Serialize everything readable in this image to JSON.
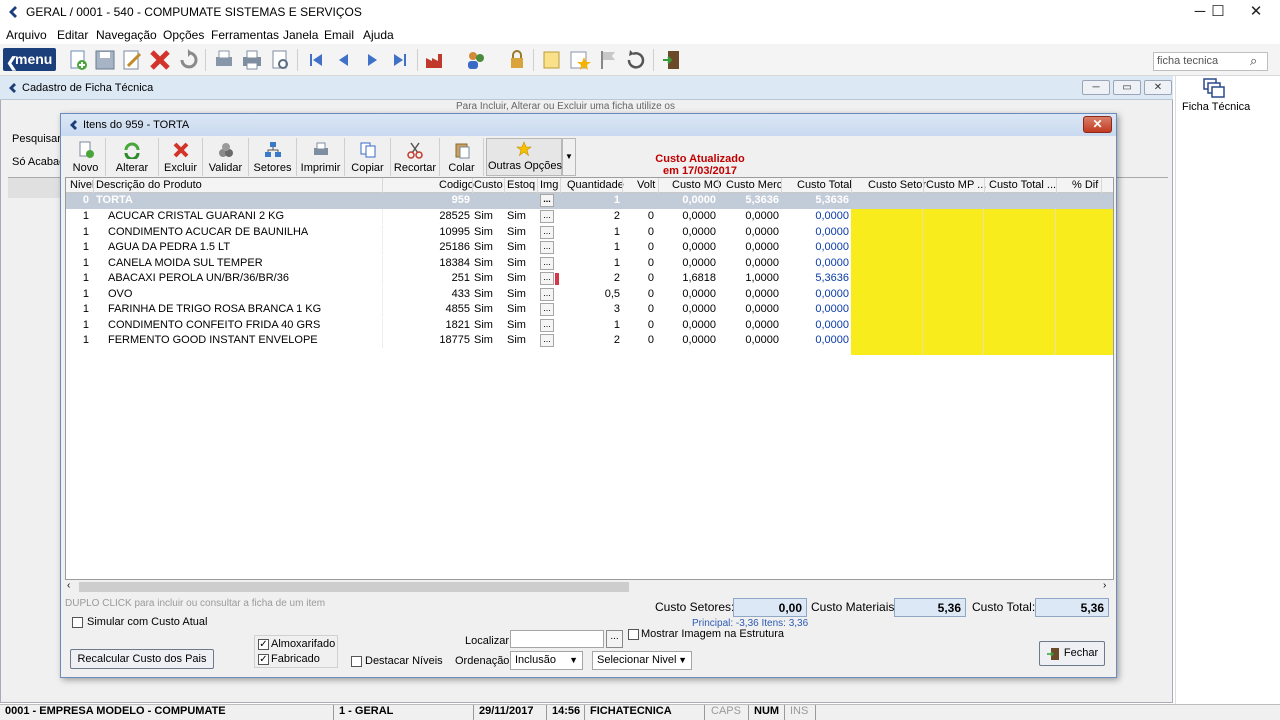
{
  "window": {
    "title": "GERAL / 0001 - 540 - COMPUMATE SISTEMAS E SERVIÇOS",
    "min": "─",
    "max": "☐",
    "close": "✕"
  },
  "menu": [
    "Arquivo",
    "Editar",
    "Navegação",
    "Opções",
    "Ferramentas",
    "Janela",
    "Email",
    "Ajuda"
  ],
  "toolbar": {
    "menu_label": "menu",
    "menu_glyph": "❮"
  },
  "search": {
    "value": "ficha tecnica"
  },
  "right_panel": {
    "label": "Ficha Técnica"
  },
  "bg_window": {
    "title": "Cadastro de Ficha Técnica",
    "hint": "Para Incluir, Alterar ou Excluir uma ficha utilize os",
    "pesquisar": "Pesquisar F",
    "so_acabados": "Só Acabad"
  },
  "dialog": {
    "title": "Itens do 959 - TORTA",
    "close": "✕",
    "buttons": [
      "Novo",
      "Alterar",
      "Excluir",
      "Validar",
      "Setores",
      "Imprimir",
      "Copiar",
      "Recortar",
      "Colar"
    ],
    "outras": "Outras Opções",
    "custo_line1": "Custo Atualizado",
    "custo_line2": "em 17/03/2017",
    "columns": [
      "Nivel",
      "Descrição do Produto",
      "Codigo",
      "Custo",
      "Estoq",
      "Img",
      "Quantidade",
      "Volt",
      "Custo MO",
      "Custo Merc",
      "Custo Total",
      "Custo Setor",
      "Custo MP ...",
      "Custo Total ...",
      "% Dif"
    ],
    "header_row": {
      "nivel": "0",
      "desc": "TORTA",
      "codigo": "959",
      "img": "...",
      "qtd": "1",
      "mo": "0,0000",
      "merc": "5,3636",
      "total": "5,3636"
    },
    "rows": [
      {
        "nivel": "1",
        "desc": "ACUCAR CRISTAL GUARANI 2 KG",
        "codigo": "28525",
        "custo": "Sim",
        "estoq": "Sim",
        "img": "...",
        "qtd": "2",
        "volt": "0",
        "mo": "0,0000",
        "merc": "0,0000",
        "total": "0,0000"
      },
      {
        "nivel": "1",
        "desc": "CONDIMENTO ACUCAR DE BAUNILHA",
        "codigo": "10995",
        "custo": "Sim",
        "estoq": "Sim",
        "img": "...",
        "qtd": "1",
        "volt": "0",
        "mo": "0,0000",
        "merc": "0,0000",
        "total": "0,0000"
      },
      {
        "nivel": "1",
        "desc": "AGUA DA PEDRA 1.5 LT",
        "codigo": "25186",
        "custo": "Sim",
        "estoq": "Sim",
        "img": "...",
        "qtd": "1",
        "volt": "0",
        "mo": "0,0000",
        "merc": "0,0000",
        "total": "0,0000"
      },
      {
        "nivel": "1",
        "desc": "CANELA MOIDA SUL TEMPER",
        "codigo": "18384",
        "custo": "Sim",
        "estoq": "Sim",
        "img": "...",
        "qtd": "1",
        "volt": "0",
        "mo": "0,0000",
        "merc": "0,0000",
        "total": "0,0000"
      },
      {
        "nivel": "1",
        "desc": "ABACAXI PEROLA UN/BR/36/BR/36",
        "codigo": "251",
        "custo": "Sim",
        "estoq": "Sim",
        "img": "...",
        "qtd": "2",
        "volt": "0",
        "mo": "1,6818",
        "merc": "1,0000",
        "total": "5,3636"
      },
      {
        "nivel": "1",
        "desc": "OVO",
        "codigo": "433",
        "custo": "Sim",
        "estoq": "Sim",
        "img": "...",
        "qtd": "0,5",
        "volt": "0",
        "mo": "0,0000",
        "merc": "0,0000",
        "total": "0,0000"
      },
      {
        "nivel": "1",
        "desc": "FARINHA DE TRIGO ROSA BRANCA 1 KG",
        "codigo": "4855",
        "custo": "Sim",
        "estoq": "Sim",
        "img": "...",
        "qtd": "3",
        "volt": "0",
        "mo": "0,0000",
        "merc": "0,0000",
        "total": "0,0000"
      },
      {
        "nivel": "1",
        "desc": "CONDIMENTO CONFEITO FRIDA 40 GRS",
        "codigo": "1821",
        "custo": "Sim",
        "estoq": "Sim",
        "img": "...",
        "qtd": "1",
        "volt": "0",
        "mo": "0,0000",
        "merc": "0,0000",
        "total": "0,0000"
      },
      {
        "nivel": "1",
        "desc": "FERMENTO GOOD INSTANT ENVELOPE",
        "codigo": "18775",
        "custo": "Sim",
        "estoq": "Sim",
        "img": "...",
        "qtd": "2",
        "volt": "0",
        "mo": "0,0000",
        "merc": "0,0000",
        "total": "0,0000"
      }
    ],
    "duplo_hint": "DUPLO CLICK para incluir ou consultar a ficha de um item",
    "custo_setores_label": "Custo Setores:",
    "custo_setores": "0,00",
    "custo_materiais_label": "Custo Materiais:",
    "custo_materiais": "5,36",
    "custo_total_label": "Custo Total:",
    "custo_total": "5,36",
    "principal": "Principal: -3,36  Itens: 3,36",
    "simular": "Simular com Custo Atual",
    "recalcular": "Recalcular Custo dos Pais",
    "almoxarifado": "Almoxarifado",
    "fabricado": "Fabricado",
    "destacar": "Destacar Níveis",
    "localizar": "Localizar:",
    "localizar_btn": "...",
    "mostrar": "Mostrar Imagem na Estrutura",
    "ordenacao": "Ordenação:",
    "ordenacao_value": "Inclusão",
    "nivel_value": "Selecionar Nivel",
    "fechar": "Fechar"
  },
  "status": {
    "empresa": "0001 - EMPRESA MODELO - COMPUMATE",
    "geral": "1 - GERAL",
    "date": "29/11/2017",
    "time": "14:56",
    "module": "FICHATECNICA",
    "caps": "CAPS",
    "num": "NUM",
    "ins": "INS"
  },
  "colors": {
    "accent": "#1b3f7a",
    "highlight_yellow": "#f8ec1c",
    "custo_red": "#c00000",
    "value_blue": "#0a3ba8"
  }
}
